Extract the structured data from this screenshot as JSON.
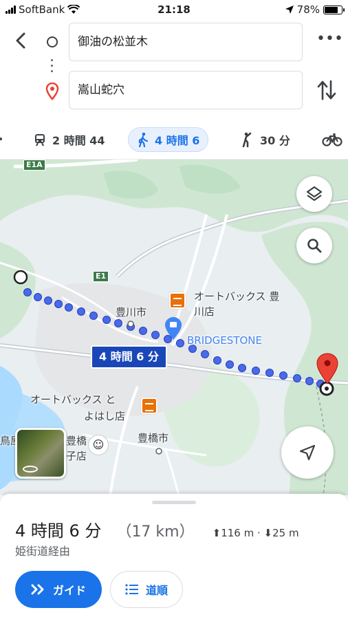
{
  "status_bar": {
    "carrier": "SoftBank",
    "time": "21:18",
    "battery": "78%",
    "battery_level": 0.78
  },
  "header": {
    "origin": "御油の松並木",
    "destination": "嵩山蛇穴"
  },
  "modes": [
    {
      "name": "transit",
      "label": "2 時間 44",
      "icon": "train-icon",
      "active": false
    },
    {
      "name": "walk",
      "label": "4 時間 6",
      "icon": "walk-icon",
      "active": true
    },
    {
      "name": "ride",
      "label": "30 分",
      "icon": "hail-icon",
      "active": false
    }
  ],
  "map": {
    "labels": {
      "toyokawa": "豊川市",
      "autobacs_toyokawa_1": "オートバックス 豊",
      "autobacs_toyokawa_2": "川店",
      "bridgestone": "BRIDGESTONE",
      "autobacs_toyohashi_1": "オートバックス と",
      "autobacs_toyohashi_2": "よはし店",
      "toyohashi": "豊橋市",
      "partial_1": "鳥屋",
      "partial_2": "豊橋",
      "partial_3": "子店",
      "e1a": "E1A",
      "e1": "E1"
    },
    "route_duration": "4 時間 6 分",
    "colors": {
      "route": "#4a6ae8",
      "accent": "#1a73e8",
      "destination_pin": "#ea4335"
    }
  },
  "sheet": {
    "duration": "4 時間 6 分",
    "distance": "（17 km）",
    "ascent": "116 m",
    "descent": "25 m",
    "separator": "·",
    "via": "姫街道経由",
    "guide_label": "ガイド",
    "steps_label": "道順"
  }
}
